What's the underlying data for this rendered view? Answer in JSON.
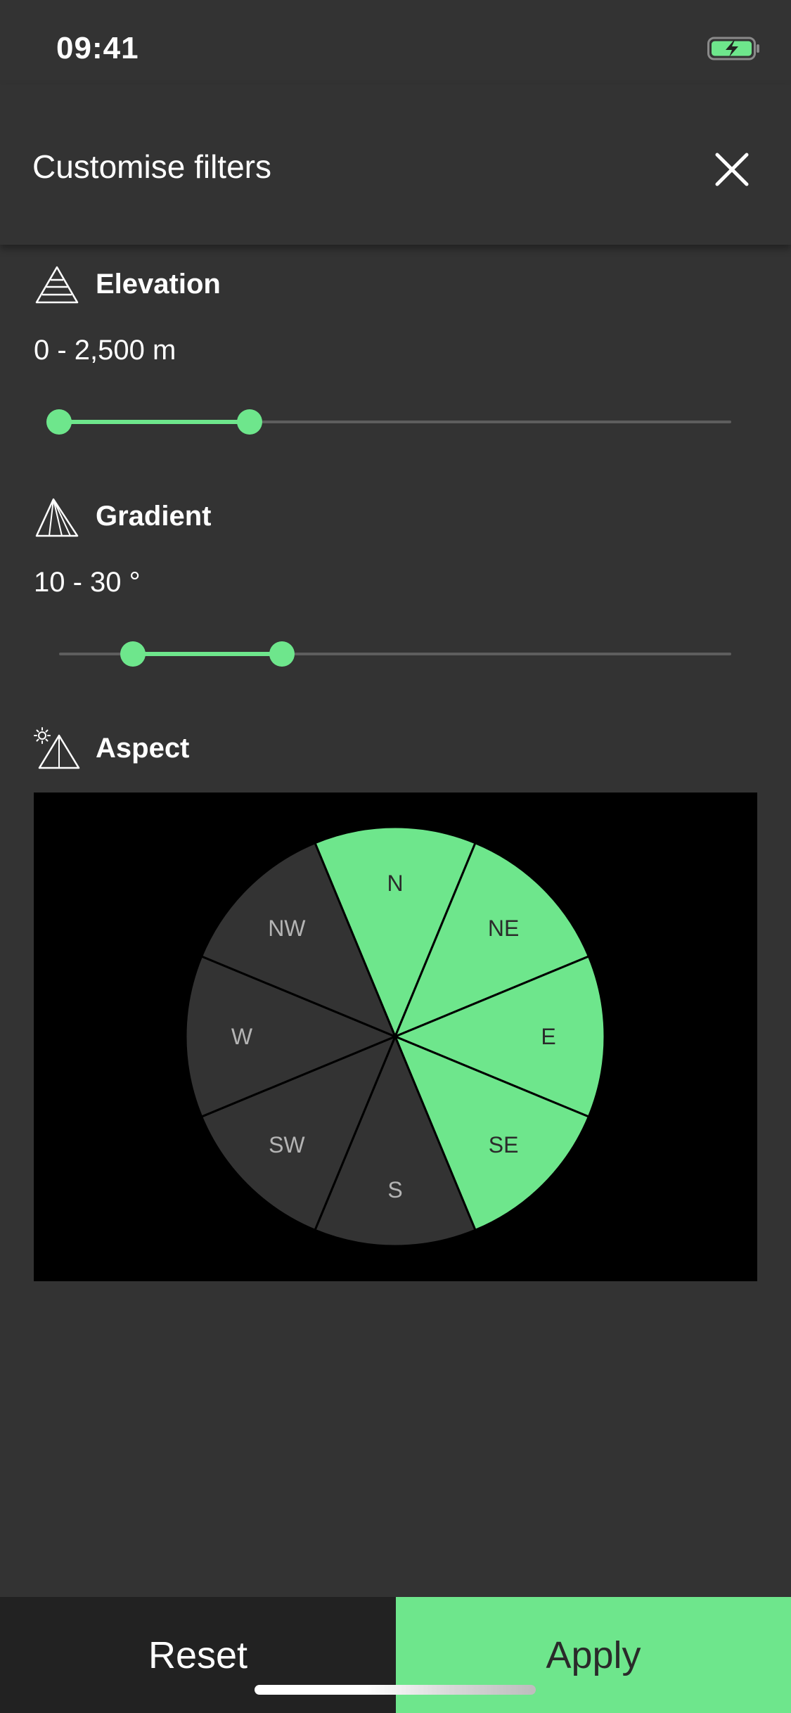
{
  "status_bar": {
    "time": "09:41",
    "battery_icon": "battery-charging-icon"
  },
  "header": {
    "title": "Customise filters",
    "close_icon": "close-icon"
  },
  "elevation": {
    "label": "Elevation",
    "icon": "elevation-icon",
    "range_text": "0 - 2,500 m",
    "slider": {
      "low_fraction": 0.0,
      "high_fraction": 0.283
    }
  },
  "gradient": {
    "label": "Gradient",
    "icon": "gradient-icon",
    "range_text": "10 - 30 °",
    "slider": {
      "low_fraction": 0.11,
      "high_fraction": 0.332
    }
  },
  "aspect": {
    "label": "Aspect",
    "icon": "aspect-icon",
    "selected_color": "#6ee68c",
    "unselected_color": "#333333",
    "sectors": [
      {
        "label": "N",
        "selected": true
      },
      {
        "label": "NE",
        "selected": true
      },
      {
        "label": "E",
        "selected": true
      },
      {
        "label": "SE",
        "selected": true
      },
      {
        "label": "S",
        "selected": false
      },
      {
        "label": "SW",
        "selected": false
      },
      {
        "label": "W",
        "selected": false
      },
      {
        "label": "NW",
        "selected": false
      }
    ]
  },
  "footer": {
    "reset_label": "Reset",
    "apply_label": "Apply"
  },
  "colors": {
    "background": "#333333",
    "accent": "#6ee68c",
    "track": "#5e5e5e"
  }
}
